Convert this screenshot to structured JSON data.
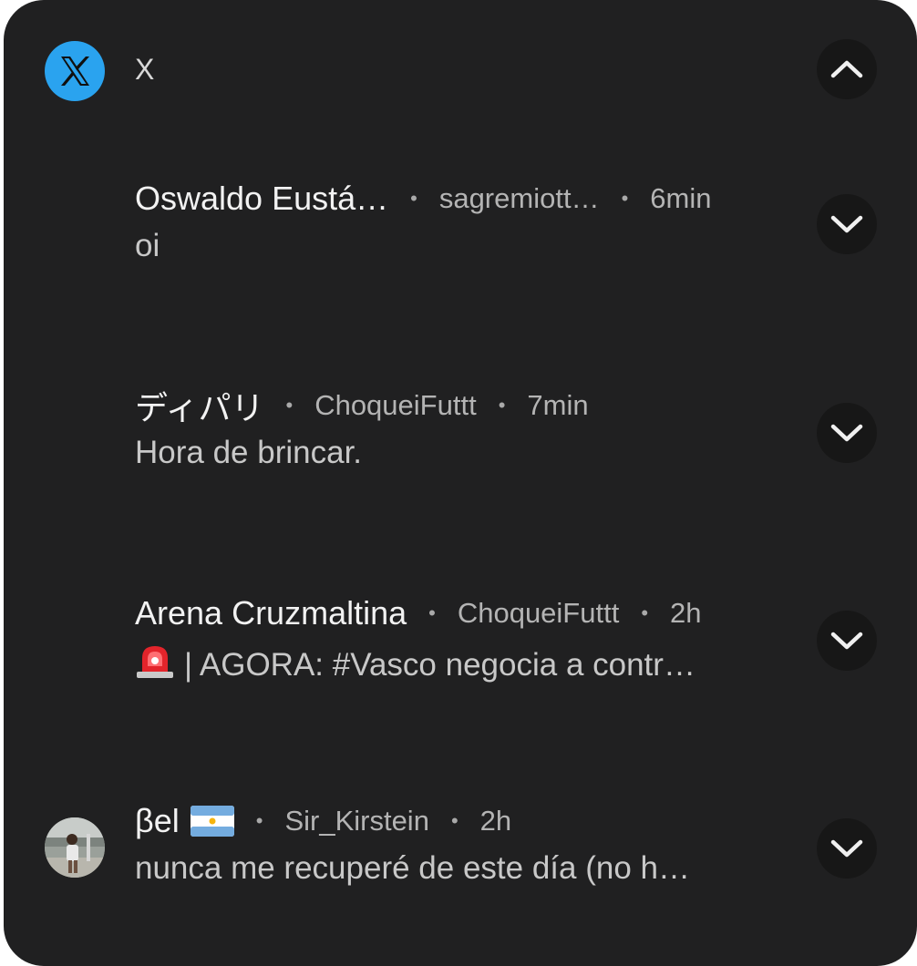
{
  "app": {
    "name": "X",
    "icon": "x-logo-icon",
    "accent": "#2aa3ef"
  },
  "header": {
    "collapse_icon": "chevron-up-icon"
  },
  "notifications": [
    {
      "sender": "Oswaldo Eustá…",
      "handle": "sagremiott…",
      "time": "6min",
      "body": "oi",
      "expand_icon": "chevron-down-icon"
    },
    {
      "sender": "ディパリ",
      "handle": "ChoqueiFuttt",
      "time": "7min",
      "body": "Hora de brincar.",
      "expand_icon": "chevron-down-icon"
    },
    {
      "sender": "Arena Cruzmaltina",
      "handle": "ChoqueiFuttt",
      "time": "2h",
      "body_prefix_icon": "police-siren-icon",
      "body": "| AGORA: #Vasco negocia a contr…",
      "expand_icon": "chevron-down-icon"
    },
    {
      "sender": "βel",
      "sender_suffix_icon": "argentina-flag-icon",
      "handle": "Sir_Kirstein",
      "time": "2h",
      "body": "nunca me recuperé de este día (no h…",
      "avatar": "user-avatar",
      "expand_icon": "chevron-down-icon"
    }
  ],
  "separator": "•",
  "colors": {
    "panel_bg": "#202021",
    "button_bg": "#171717",
    "text_primary": "#f2f2f2",
    "text_secondary": "#b4b4b4"
  }
}
